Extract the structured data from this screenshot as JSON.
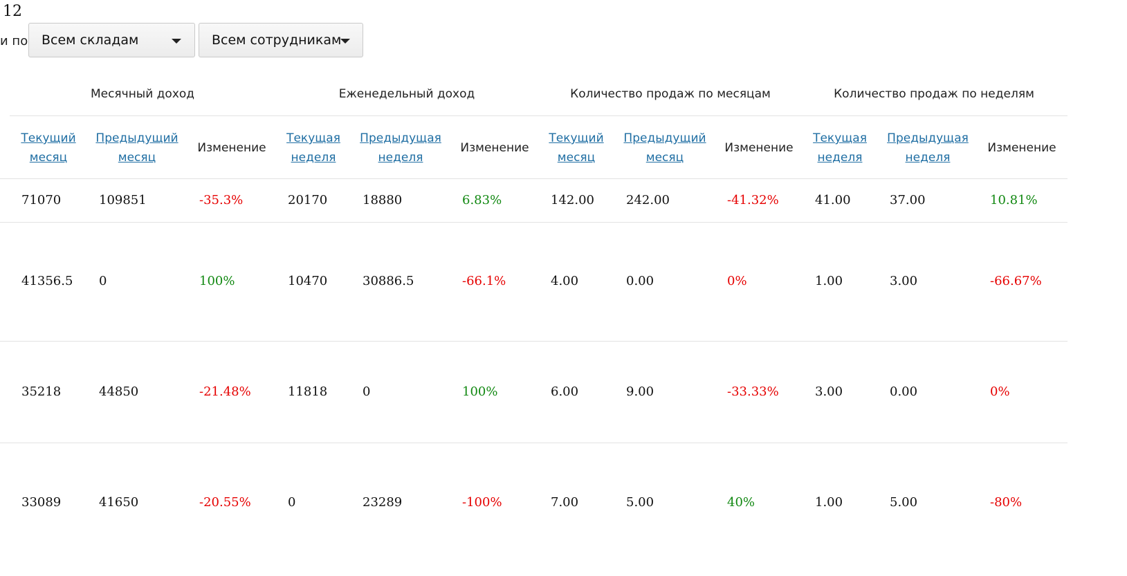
{
  "top_number": "12",
  "filter": {
    "label": "и по",
    "warehouse_select": "Всем складам",
    "employee_select": "Всем сотрудникам"
  },
  "groups": [
    "Месячный доход",
    "Еженедельный доход",
    "Количество продаж по месяцам",
    "Количество продаж по неделям"
  ],
  "columns": [
    {
      "l1": "Текущий",
      "l2": "месяц",
      "link": true
    },
    {
      "l1": "Предыдущий",
      "l2": "месяц",
      "link": true
    },
    {
      "l1": "Изменение",
      "l2": "",
      "link": false
    },
    {
      "l1": "Текущая",
      "l2": "неделя",
      "link": true
    },
    {
      "l1": "Предыдущая",
      "l2": "неделя",
      "link": true
    },
    {
      "l1": "Изменение",
      "l2": "",
      "link": false
    },
    {
      "l1": "Текущий",
      "l2": "месяц",
      "link": true
    },
    {
      "l1": "Предыдущий",
      "l2": "месяц",
      "link": true
    },
    {
      "l1": "Изменение",
      "l2": "",
      "link": false
    },
    {
      "l1": "Текущая",
      "l2": "неделя",
      "link": true
    },
    {
      "l1": "Предыдущая",
      "l2": "неделя",
      "link": true
    },
    {
      "l1": "Изменение",
      "l2": "",
      "link": false
    }
  ],
  "rows": [
    [
      "71070",
      "109851",
      "-35.3%",
      "20170",
      "18880",
      "6.83%",
      "142.00",
      "242.00",
      "-41.32%",
      "41.00",
      "37.00",
      "10.81%"
    ],
    [
      "41356.5",
      "0",
      "100%",
      "10470",
      "30886.5",
      "-66.1%",
      "4.00",
      "0.00",
      "0%",
      "1.00",
      "3.00",
      "-66.67%"
    ],
    [
      "35218",
      "44850",
      "-21.48%",
      "11818",
      "0",
      "100%",
      "6.00",
      "9.00",
      "-33.33%",
      "3.00",
      "0.00",
      "0%"
    ],
    [
      "33089",
      "41650",
      "-20.55%",
      "0",
      "23289",
      "-100%",
      "7.00",
      "5.00",
      "40%",
      "1.00",
      "5.00",
      "-80%"
    ]
  ],
  "colors": {
    "negative": "#e60000",
    "positive": "#118811",
    "link": "#1f6ea3"
  }
}
